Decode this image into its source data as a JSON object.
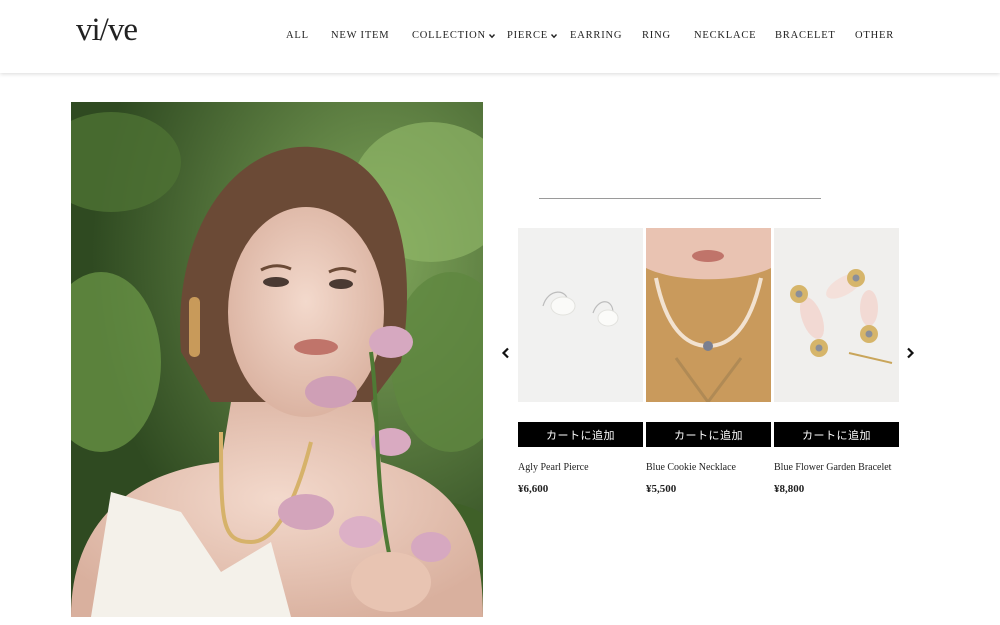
{
  "brand": {
    "logo_text": "vi/ve"
  },
  "nav": {
    "items": [
      {
        "label": "ALL",
        "dropdown": false
      },
      {
        "label": "NEW ITEM",
        "dropdown": false
      },
      {
        "label": "COLLECTION",
        "dropdown": true
      },
      {
        "label": "PIERCE",
        "dropdown": true
      },
      {
        "label": "EARRING",
        "dropdown": false
      },
      {
        "label": "RING",
        "dropdown": false
      },
      {
        "label": "NECKLACE",
        "dropdown": false
      },
      {
        "label": "BRACELET",
        "dropdown": false
      },
      {
        "label": "OTHER",
        "dropdown": false
      }
    ]
  },
  "carousel": {
    "prev_icon": "chevron-left-icon",
    "next_icon": "chevron-right-icon",
    "products": [
      {
        "name": "Agly Pearl Pierce",
        "price": "¥6,600",
        "cart_label": "カートに追加"
      },
      {
        "name": "Blue Cookie Necklace",
        "price": "¥5,500",
        "cart_label": "カートに追加"
      },
      {
        "name": "Blue Flower Garden Bracelet",
        "price": "¥8,800",
        "cart_label": "カートに追加"
      }
    ]
  },
  "colors": {
    "button_bg": "#000000",
    "button_text": "#ffffff",
    "divider": "#9a9a9a"
  }
}
